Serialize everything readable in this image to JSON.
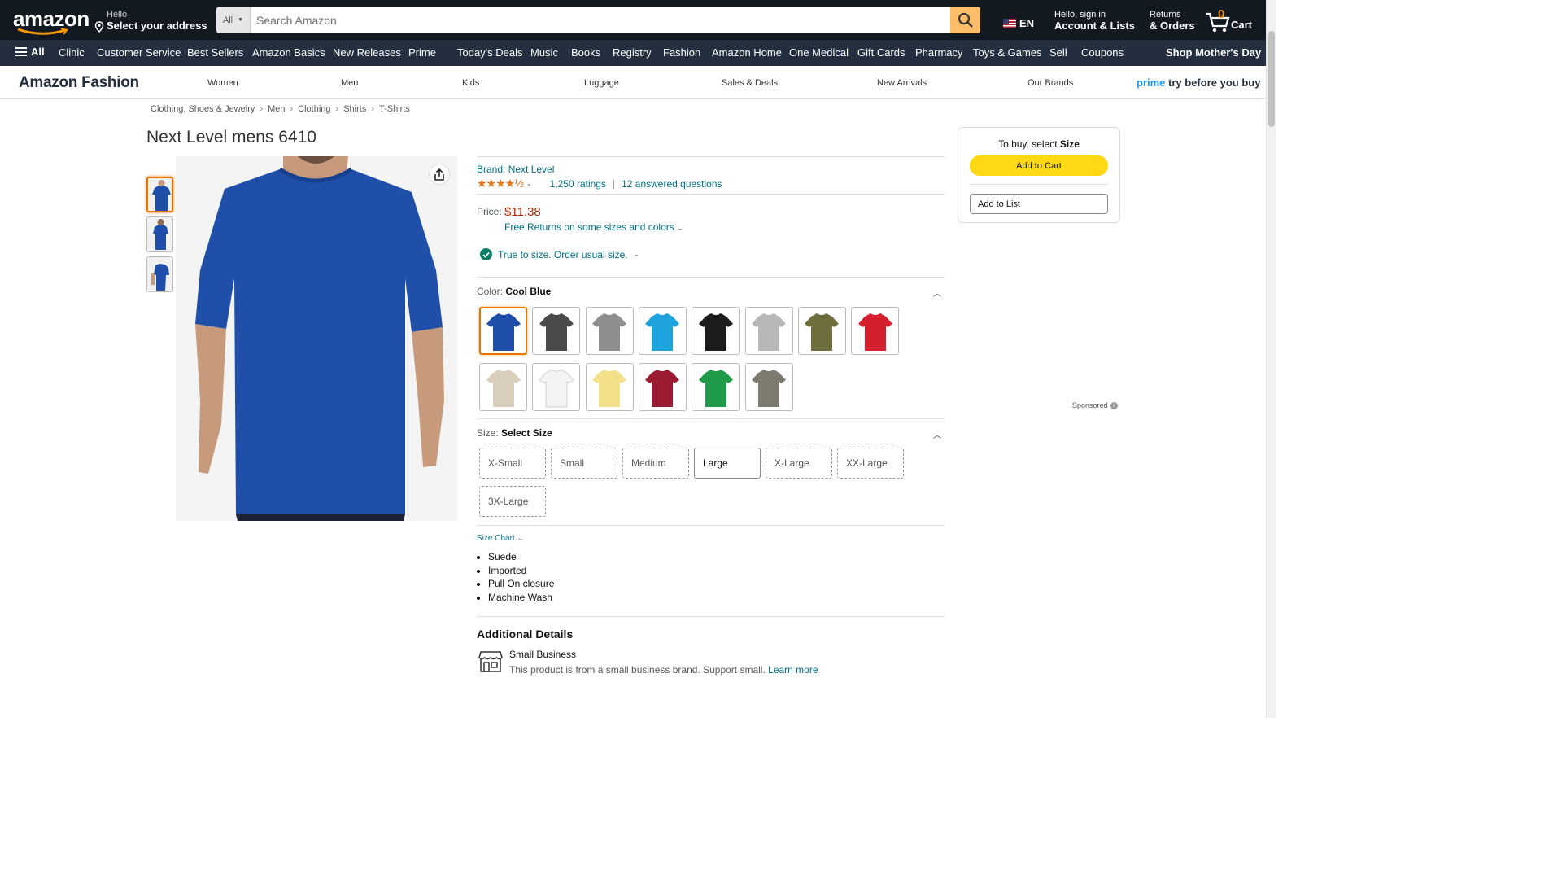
{
  "header": {
    "logo": "amazon",
    "address_hello": "Hello",
    "address_label": "Select your address",
    "search_category": "All",
    "search_placeholder": "Search Amazon",
    "language": "EN",
    "account_hello": "Hello, sign in",
    "account_label": "Account & Lists",
    "returns_l1": "Returns",
    "returns_l2": "& Orders",
    "cart_count": "0",
    "cart_label": "Cart"
  },
  "nav": {
    "all_label": "All",
    "items": [
      "Clinic",
      "Customer Service",
      "Best Sellers",
      "Amazon Basics",
      "New Releases",
      "Prime",
      "Today's Deals",
      "Music",
      "Books",
      "Registry",
      "Fashion",
      "Amazon Home",
      "One Medical",
      "Gift Cards",
      "Pharmacy",
      "Toys & Games",
      "Sell",
      "Coupons"
    ],
    "promo": "Shop Mother's Day"
  },
  "fashion_nav": {
    "brand": "Amazon Fashion",
    "items": [
      "Women",
      "Men",
      "Kids",
      "Luggage",
      "Sales & Deals",
      "New Arrivals",
      "Our Brands"
    ],
    "prime_word": "prime",
    "prime_rest": " try before you buy"
  },
  "breadcrumb": [
    "Clothing, Shoes & Jewelry",
    "Men",
    "Clothing",
    "Shirts",
    "T-Shirts"
  ],
  "product": {
    "title": "Next Level mens 6410",
    "brand_link": "Brand: Next Level",
    "stars": "★★★★½",
    "rating_value": 4.5,
    "ratings_count": "1,250 ratings",
    "answered": "12 answered questions",
    "price_label": "Price:",
    "price": "$11.38",
    "free_returns": "Free Returns on some sizes and colors",
    "fit": "True to size. Order usual size.",
    "color_label": "Color: ",
    "color_selected": "Cool Blue",
    "swatch_colors": [
      "#1f4fa8",
      "#4a4a4a",
      "#8e8e8e",
      "#1fa3dc",
      "#1c1c1c",
      "#b8b8b8",
      "#6d6e3c",
      "#d4202e",
      "#d9cdbb",
      "#f4f4f4",
      "#f3e08a",
      "#9b1b33",
      "#1e9a48",
      "#7d7a70"
    ],
    "size_label": "Size: ",
    "size_selected": "Select Size",
    "sizes": [
      "X-Small",
      "Small",
      "Medium",
      "Large",
      "X-Large",
      "XX-Large",
      "3X-Large"
    ],
    "size_chart": "Size Chart",
    "bullets": [
      "Suede",
      "Imported",
      "Pull On closure",
      "Machine Wash"
    ],
    "additional_details": "Additional Details",
    "small_business_title": "Small Business",
    "small_business_desc": "This product is from a small business brand. Support small.",
    "learn_more": "Learn more"
  },
  "buybox": {
    "prompt_prefix": "To buy, select ",
    "prompt_bold": "Size",
    "add_to_cart": "Add to Cart",
    "add_to_list": "Add to List"
  },
  "sponsored": "Sponsored",
  "colors": {
    "nav_dark": "#131921",
    "nav_sub": "#232f3e",
    "search_btn": "#febd69",
    "price": "#b12704",
    "link": "#007185",
    "cart_yellow": "#ffd814",
    "selected_border": "#e77600"
  }
}
